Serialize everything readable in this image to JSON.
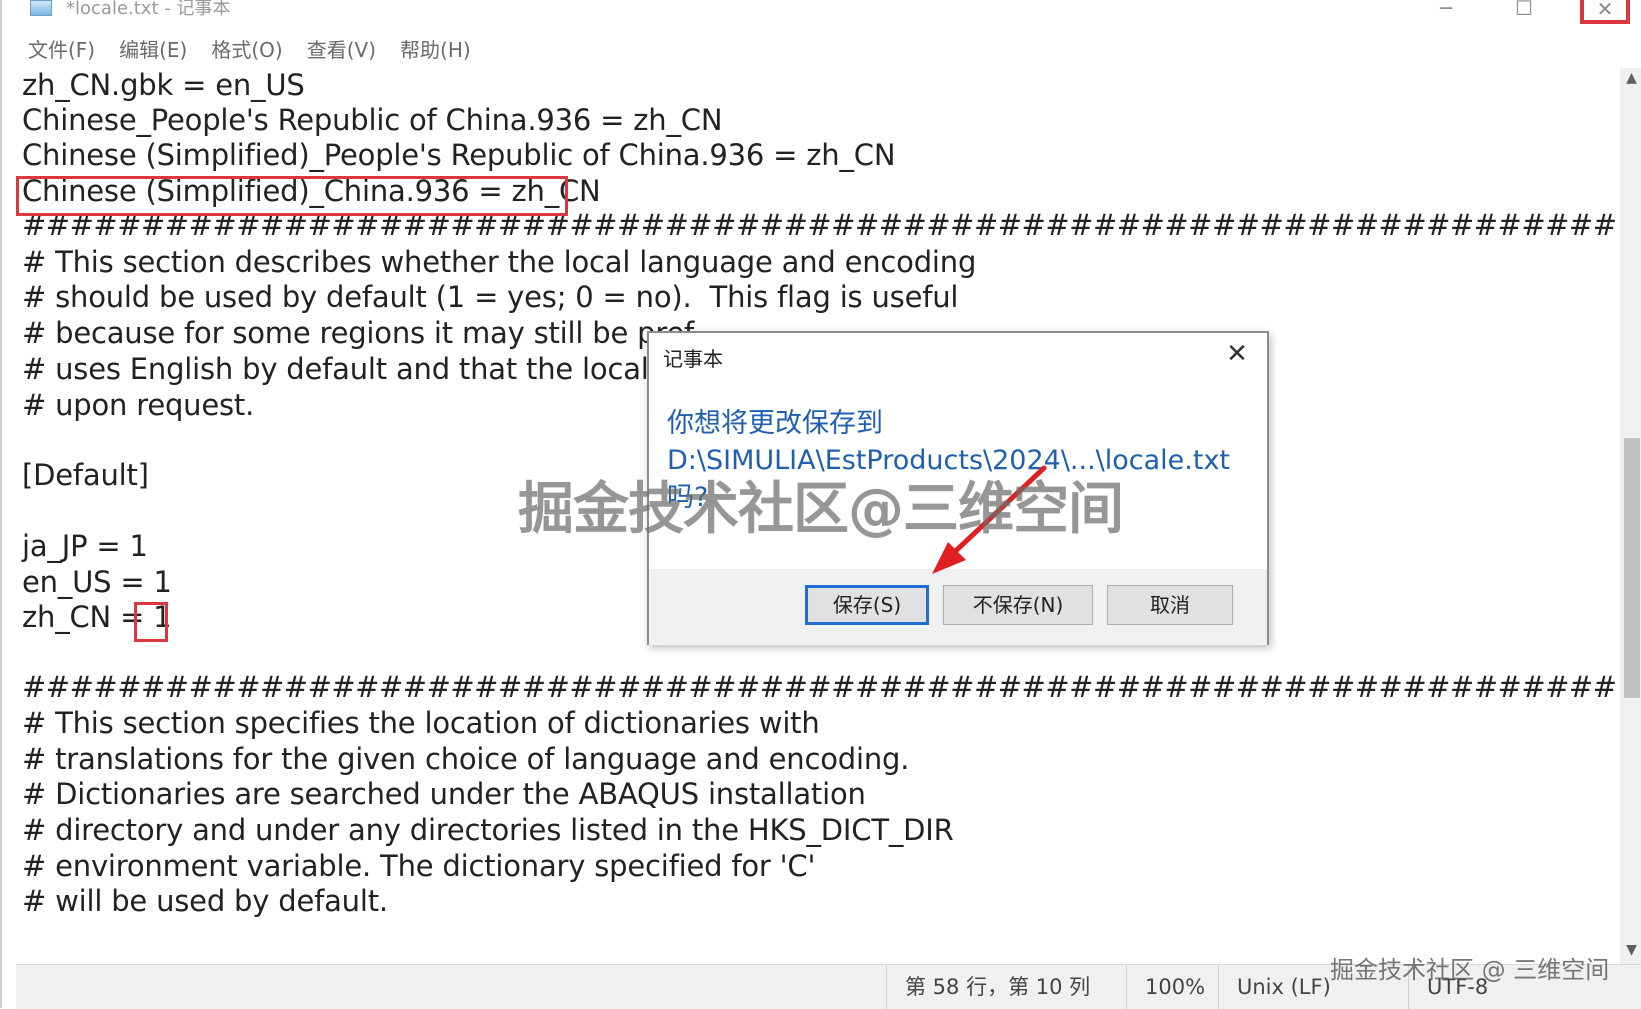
{
  "window": {
    "title": "*locale.txt - 记事本",
    "controls": {
      "minimize": "─",
      "maximize": "☐",
      "close": "✕"
    }
  },
  "menu": {
    "items": [
      "文件(F)",
      "编辑(E)",
      "格式(O)",
      "查看(V)",
      "帮助(H)"
    ]
  },
  "editor": {
    "lines": [
      "zh_CN.gbk = en_US",
      "Chinese_People's Republic of China.936 = zh_CN",
      "Chinese (Simplified)_People's Republic of China.936 = zh_CN",
      "Chinese (Simplified)_China.936 = zh_CN",
      "#########################################################################",
      "# This section describes whether the local language and encoding",
      "# should be used by default (1 = yes; 0 = no).  This flag is useful",
      "# because for some regions it may still be pref",
      "# uses English by default and that the local lan",
      "# upon request.",
      "",
      "[Default]",
      "",
      "ja_JP = 1",
      "en_US = 1",
      "zh_CN = 1",
      "",
      "#########################################################################",
      "# This section specifies the location of dictionaries with",
      "# translations for the given choice of language and encoding.",
      "# Dictionaries are searched under the ABAQUS installation",
      "# directory and under any directories listed in the HKS_DICT_DIR",
      "# environment variable. The dictionary specified for 'C'",
      "# will be used by default."
    ]
  },
  "statusbar": {
    "position": "第 58 行，第 10 列",
    "zoom": "100%",
    "line_ending": "Unix (LF)",
    "encoding": "UTF-8"
  },
  "dialog": {
    "title": "记事本",
    "close": "✕",
    "message_line1": "你想将更改保存到",
    "message_line2": "D:\\SIMULIA\\EstProducts\\2024\\...\\locale.txt",
    "message_line3": "吗?",
    "buttons": {
      "save": "保存(S)",
      "dont_save": "不保存(N)",
      "cancel": "取消"
    }
  },
  "watermark": {
    "center": "掘金技术社区@三维空间",
    "corner": "掘金技术社区 @ 三维空间"
  },
  "colors": {
    "highlight": "#d9383f",
    "dialog_text": "#1f5fb0",
    "primary_button_border": "#1e6fd0"
  }
}
